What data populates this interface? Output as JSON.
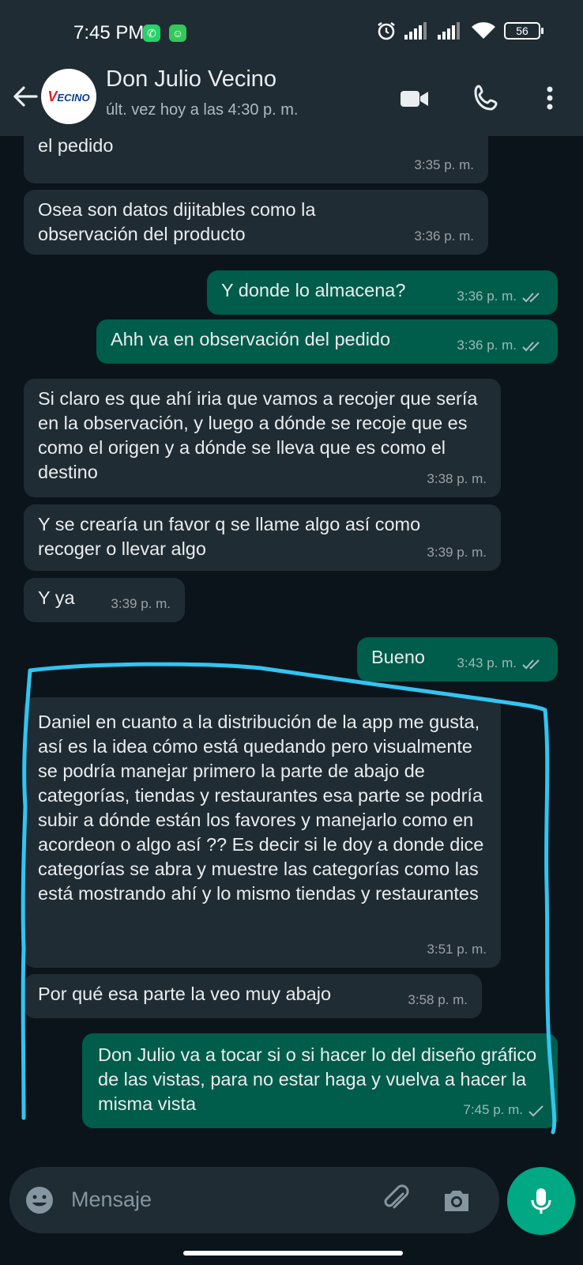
{
  "status_bar": {
    "time": "7:45 PM",
    "battery": "56",
    "icons": [
      "whatsapp-icon",
      "android-icon",
      "alarm-icon",
      "signal-icon",
      "signal-icon",
      "wifi-icon",
      "battery-icon"
    ]
  },
  "header": {
    "contact_name": "Don Julio Vecino",
    "status": "últ. vez hoy a las 4:30 p. m.",
    "avatar_text_a": "V",
    "avatar_text_b": "ECINO"
  },
  "messages": [
    {
      "dir": "in",
      "text": "dato de origen y destino iria es cuando se va hacer el pedido",
      "time": "3:35 p. m."
    },
    {
      "dir": "in",
      "text": "Osea son datos dijitables como la observación del producto",
      "time": "3:36 p. m."
    },
    {
      "dir": "out",
      "text": "Y donde lo almacena?",
      "time": "3:36 p. m.",
      "ticks": "read"
    },
    {
      "dir": "out",
      "text": "Ahh va en observación del pedido",
      "time": "3:36 p. m.",
      "ticks": "read"
    },
    {
      "dir": "in",
      "text": "Si claro es que ahí iria que vamos a recojer que sería en la observación, y luego a dónde se recoje que es como el origen y a dónde se lleva que es como el destino",
      "time": "3:38 p. m."
    },
    {
      "dir": "in",
      "text": "Y se crearía un favor q se llame algo así como recoger o llevar algo",
      "time": "3:39 p. m."
    },
    {
      "dir": "in",
      "text": "Y ya",
      "time": "3:39 p. m."
    },
    {
      "dir": "out",
      "text": "Bueno",
      "time": "3:43 p. m.",
      "ticks": "read"
    },
    {
      "dir": "in",
      "text": "Daniel en cuanto a la distribución de la app me  gusta,  así es la idea cómo está quedando pero visualmente  se podría manejar primero la parte de abajo de categorías, tiendas y restaurantes esa parte se podría subir a dónde están los favores y manejarlo como en acordeon o algo así ??  Es decir si le doy a donde dice categorías se abra y muestre las categorías como las está mostrando ahí y lo mismo tiendas y restaurantes",
      "time": "3:51 p. m."
    },
    {
      "dir": "in",
      "text": "Por qué esa parte la veo muy abajo",
      "time": "3:58 p. m."
    },
    {
      "dir": "out",
      "text": "Don Julio va a tocar si o si hacer lo del diseño gráfico de las vistas, para no estar haga y vuelva a hacer la misma vista",
      "time": "7:45 p. m.",
      "ticks": "sent"
    }
  ],
  "input": {
    "placeholder": "Mensaje"
  },
  "colors": {
    "background": "#0b141a",
    "header": "#1f2c34",
    "incoming_bubble": "#202c33",
    "outgoing_bubble": "#005c4b",
    "accent": "#00a884",
    "annotation_stroke": "#33c4f0"
  }
}
